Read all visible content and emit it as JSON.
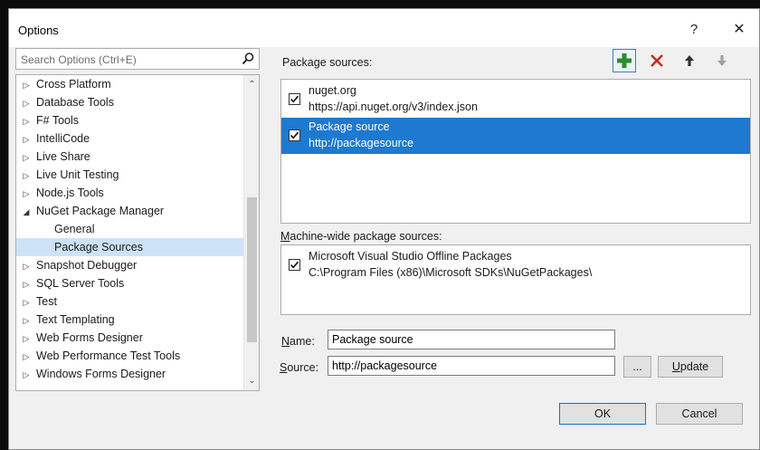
{
  "window": {
    "title": "Options",
    "help_label": "?",
    "close_label": "✕"
  },
  "search": {
    "placeholder": "Search Options (Ctrl+E)"
  },
  "tree": {
    "items": [
      {
        "label": "Cross Platform",
        "caret": "▷"
      },
      {
        "label": "Database Tools",
        "caret": "▷"
      },
      {
        "label": "F# Tools",
        "caret": "▷"
      },
      {
        "label": "IntelliCode",
        "caret": "▷"
      },
      {
        "label": "Live Share",
        "caret": "▷"
      },
      {
        "label": "Live Unit Testing",
        "caret": "▷"
      },
      {
        "label": "Node.js Tools",
        "caret": "▷"
      },
      {
        "label": "NuGet Package Manager",
        "caret": "◢"
      },
      {
        "label": "General",
        "caret": ""
      },
      {
        "label": "Package Sources",
        "caret": ""
      },
      {
        "label": "Snapshot Debugger",
        "caret": "▷"
      },
      {
        "label": "SQL Server Tools",
        "caret": "▷"
      },
      {
        "label": "Test",
        "caret": "▷"
      },
      {
        "label": "Text Templating",
        "caret": "▷"
      },
      {
        "label": "Web Forms Designer",
        "caret": "▷"
      },
      {
        "label": "Web Performance Test Tools",
        "caret": "▷"
      },
      {
        "label": "Windows Forms Designer",
        "caret": "▷"
      }
    ],
    "selected_index": 9
  },
  "package_sources": {
    "label": "Package sources:",
    "items": [
      {
        "name": "nuget.org",
        "url": "https://api.nuget.org/v3/index.json",
        "checked": true
      },
      {
        "name": "Package source",
        "url": "http://packagesource",
        "checked": true
      }
    ]
  },
  "machine_wide": {
    "label_prefix": "M",
    "label_rest": "achine-wide package sources:",
    "items": [
      {
        "name": "Microsoft Visual Studio Offline Packages",
        "url": "C:\\Program Files (x86)\\Microsoft SDKs\\NuGetPackages\\",
        "checked": true
      }
    ]
  },
  "form": {
    "name_label_prefix": "N",
    "name_label_rest": "ame:",
    "name_value": "Package source",
    "source_label_prefix": "S",
    "source_label_rest": "ource:",
    "source_value": "http://packagesource",
    "browse_label": "...",
    "update_label_prefix": "U",
    "update_label_rest": "pdate"
  },
  "footer": {
    "ok_label": "OK",
    "cancel_label": "Cancel"
  },
  "colors": {
    "selection": "#1e79d1",
    "tree_selection": "#cde3f5",
    "add_icon": "#2e8b2e",
    "remove_icon": "#c42b1c"
  }
}
